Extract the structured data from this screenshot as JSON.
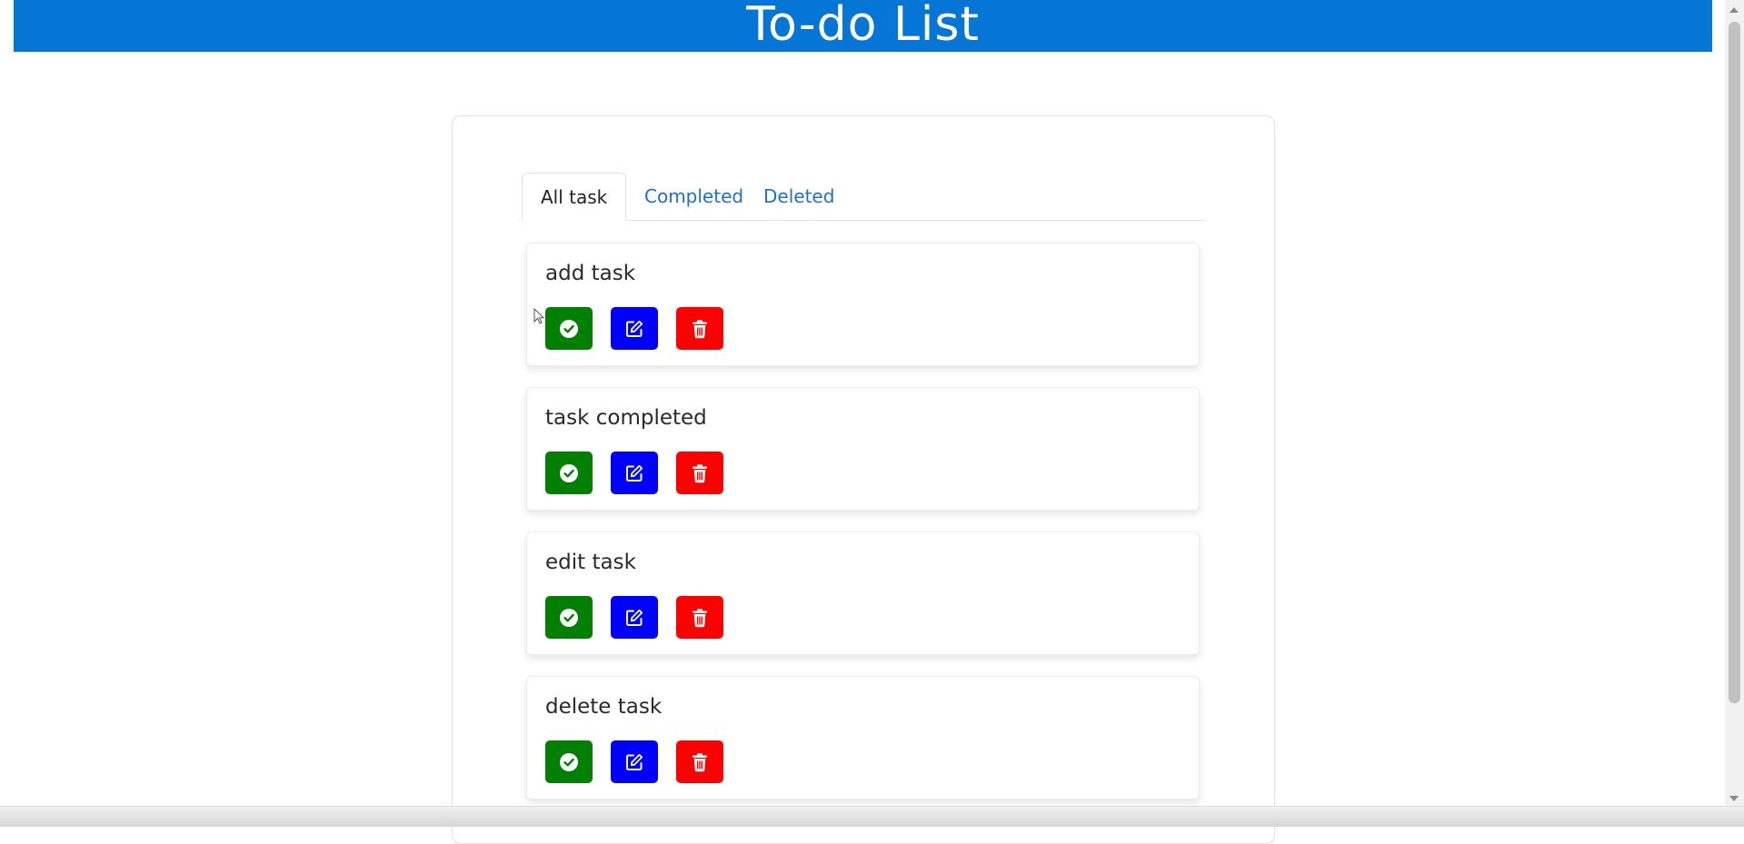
{
  "header": {
    "title": "To-do List"
  },
  "tabs": [
    {
      "label": "All task",
      "active": true
    },
    {
      "label": "Completed",
      "active": false
    },
    {
      "label": "Deleted",
      "active": false
    }
  ],
  "tasks": [
    {
      "title": "add task"
    },
    {
      "title": "task completed"
    },
    {
      "title": "edit task"
    },
    {
      "title": "delete task"
    }
  ],
  "icons": {
    "complete": "check-circle-icon",
    "edit": "edit-icon",
    "delete": "trash-icon"
  },
  "colors": {
    "header": "#0575d6",
    "complete": "#008000",
    "edit": "#0000ff",
    "delete": "#ff0000",
    "tab_link": "#1e6fd1"
  }
}
